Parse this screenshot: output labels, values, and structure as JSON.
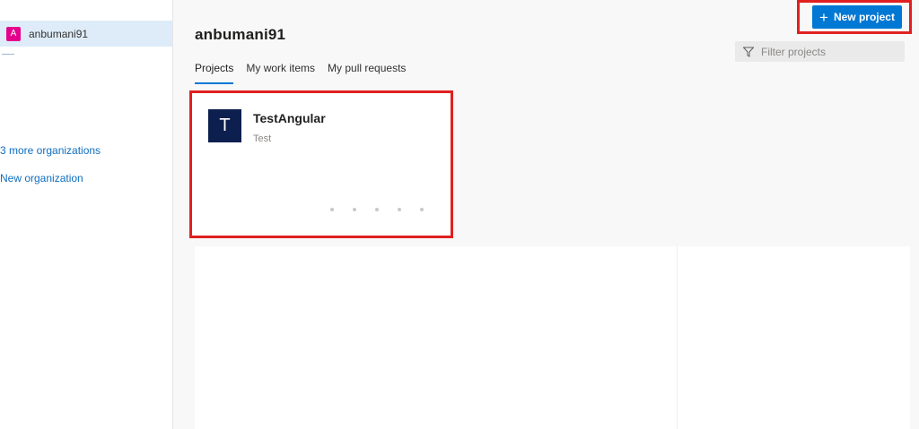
{
  "sidebar": {
    "org": {
      "initial": "A",
      "name": "anbumani91"
    },
    "more_orgs_label": "3 more organizations",
    "new_org_label": "New organization"
  },
  "header": {
    "title": "anbumani91",
    "new_project_label": "New project",
    "filter_placeholder": "Filter projects"
  },
  "tabs": [
    {
      "label": "Projects",
      "active": true
    },
    {
      "label": "My work items",
      "active": false
    },
    {
      "label": "My pull requests",
      "active": false
    }
  ],
  "projects": [
    {
      "initial": "T",
      "name": "TestAngular",
      "description": "Test"
    }
  ],
  "colors": {
    "accent": "#0078d4",
    "org_avatar": "#e3008c",
    "project_avatar": "#0d1f4e",
    "highlight": "#e02020"
  },
  "icons": {
    "new_project": "plus-icon",
    "filter": "filter-icon",
    "card_menu": "more-dots-icon"
  }
}
